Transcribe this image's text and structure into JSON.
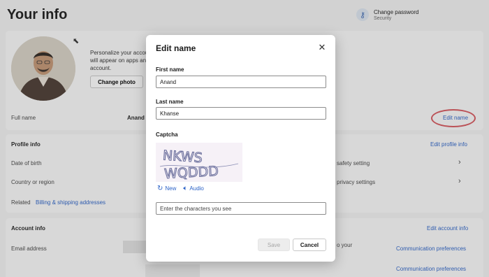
{
  "page": {
    "title": "Your info",
    "change_password": {
      "title": "Change password",
      "subtitle": "Security",
      "icon": "key-icon"
    }
  },
  "profile_card": {
    "personalize_text": "Personalize your account. This will appear on apps and account.",
    "personalize_lines": [
      "Personalize your accou",
      "will appear on apps an",
      "account."
    ],
    "change_photo_label": "Change photo",
    "full_name_label": "Full name",
    "full_name_value": "Anand",
    "edit_name_link": "Edit name"
  },
  "profile_info": {
    "heading": "Profile info",
    "edit_link": "Edit profile info",
    "rows": [
      {
        "label": "Date of birth",
        "right_text": "safety setting"
      },
      {
        "label": "Country or region",
        "right_text": "privacy settings"
      }
    ],
    "related_label": "Related",
    "related_link": "Billing & shipping addresses"
  },
  "account_info": {
    "heading": "Account info",
    "edit_link": "Edit account info",
    "email_label": "Email address",
    "mid_text": "o your",
    "comm_pref_1": "Communication preferences",
    "comm_pref_2": "Communication preferences"
  },
  "dialog": {
    "title": "Edit name",
    "close_icon": "close-icon",
    "first_name_label": "First name",
    "first_name_value": "Anand",
    "last_name_label": "Last name",
    "last_name_value": "Khanse",
    "captcha_label": "Captcha",
    "captcha_text": "NKWS WQDDD",
    "new_label": "New",
    "audio_label": "Audio",
    "captcha_input_placeholder": "Enter the characters you see",
    "save_label": "Save",
    "cancel_label": "Cancel"
  },
  "colors": {
    "accent": "#2b62c7",
    "highlight_ring": "#d7575d"
  }
}
